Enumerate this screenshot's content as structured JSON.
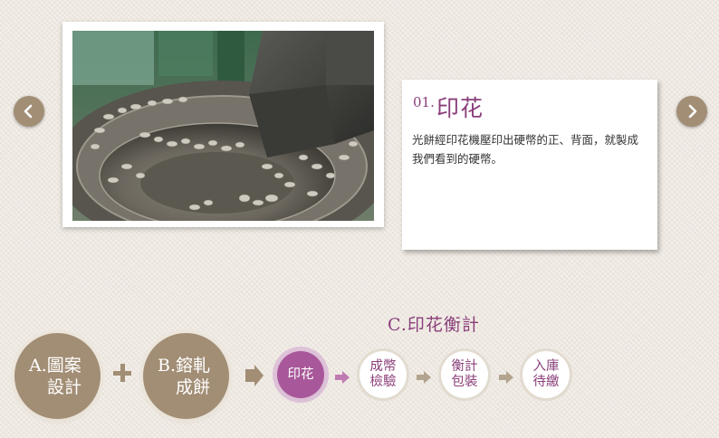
{
  "slider": {
    "prev_icon": "chevron-left-icon",
    "next_icon": "chevron-right-icon"
  },
  "step": {
    "number": "01.",
    "title": "印花",
    "description": "光餅經印花機壓印出硬幣的正、背面，就製成我們看到的硬幣。"
  },
  "flow": {
    "subtitle": "C.印花衡計",
    "stage_a": {
      "line1": "A.圖案",
      "line2": "設計"
    },
    "stage_b": {
      "line1": "B.鎔軋",
      "line2": "成餅"
    },
    "steps": [
      {
        "line1": "印花",
        "line2": ""
      },
      {
        "line1": "成幣",
        "line2": "檢驗"
      },
      {
        "line1": "衡計",
        "line2": "包裝"
      },
      {
        "line1": "入庫",
        "line2": "待繳"
      }
    ]
  },
  "colors": {
    "accent": "#8a3f7a",
    "active_step": "#a8589a",
    "taupe": "#a28e75",
    "background": "#efe9e1"
  }
}
